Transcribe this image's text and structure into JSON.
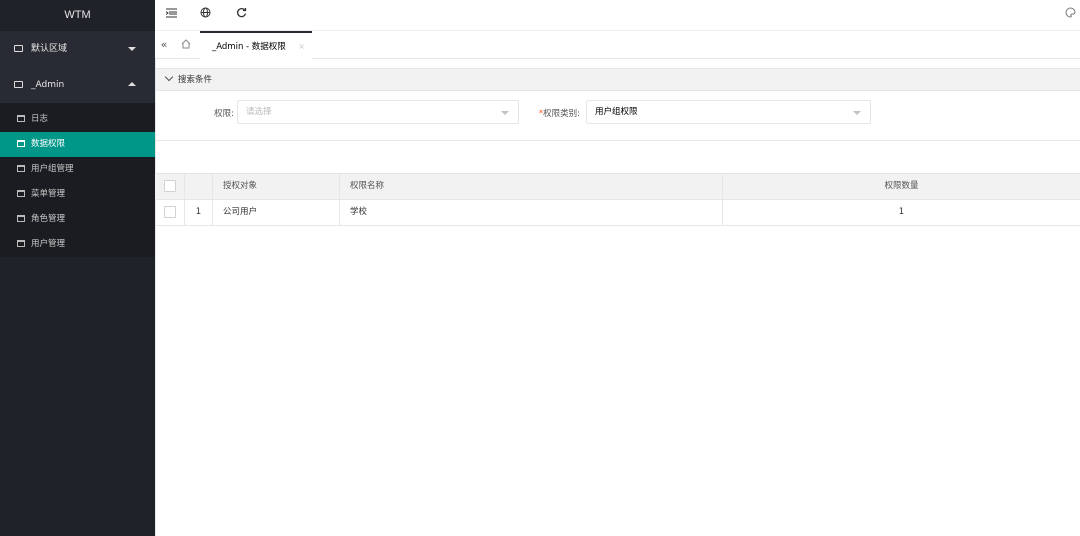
{
  "sidebar": {
    "logo": "WTM",
    "groups": [
      {
        "label": "默认区域",
        "expanded": false
      },
      {
        "label": "_Admin",
        "expanded": true
      }
    ],
    "items": [
      {
        "label": "日志",
        "active": false
      },
      {
        "label": "数据权限",
        "active": true
      },
      {
        "label": "用户组管理",
        "active": false
      },
      {
        "label": "菜单管理",
        "active": false
      },
      {
        "label": "角色管理",
        "active": false
      },
      {
        "label": "用户管理",
        "active": false
      }
    ]
  },
  "topbar": {
    "icons": [
      "menu-fold-icon",
      "globe-icon",
      "refresh-icon",
      "theme-icon"
    ]
  },
  "tabs": {
    "items": [
      {
        "label": "_Admin - 数据权限",
        "close": "×"
      }
    ]
  },
  "search": {
    "title": "搜索条件",
    "fields": [
      {
        "label": "权限:",
        "placeholder": "请选择",
        "value": ""
      },
      {
        "label": "权限类别:",
        "required_mark": "*",
        "value": "用户组权限"
      }
    ]
  },
  "table": {
    "columns": [
      "授权对象",
      "权限名称",
      "权限数量"
    ],
    "rows": [
      {
        "index": "1",
        "cells": [
          "公司用户",
          "学校",
          "1"
        ]
      }
    ]
  },
  "colors": {
    "sidebar_bg": "#20222a",
    "active": "#009688",
    "required": "#ff5722"
  }
}
